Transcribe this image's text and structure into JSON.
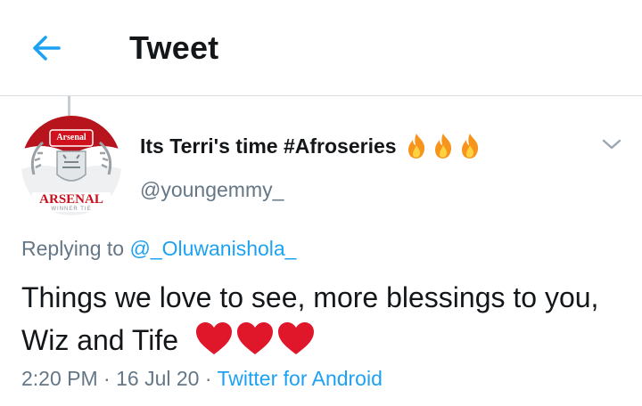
{
  "header": {
    "back_icon": "arrow-left-icon",
    "title": "Tweet"
  },
  "tweet": {
    "author": {
      "display_name": "Its Terri's time #Afroseries",
      "name_emoji": [
        "fire-emoji",
        "fire-emoji",
        "fire-emoji"
      ],
      "handle": "@youngemmy_",
      "avatar": {
        "badge_text": "Arsenal",
        "club_text": "ARSENAL",
        "sub_text": "WINNER TIE"
      }
    },
    "menu_icon": "chevron-down-icon",
    "replying_prefix": "Replying to",
    "replying_to": "@_Oluwanishola_",
    "text": "Things we love to see, more blessings to you, Wiz and Tife",
    "text_emoji": [
      "red-heart-emoji",
      "red-heart-emoji",
      "red-heart-emoji"
    ],
    "time": "2:20 PM",
    "separator": "·",
    "date": "16 Jul 20",
    "source": "Twitter for Android"
  },
  "colors": {
    "accent": "#1da1f2",
    "secondary_text": "#657786",
    "primary_text": "#14171a",
    "heart": "#e0162b",
    "divider": "#d8dde2"
  }
}
